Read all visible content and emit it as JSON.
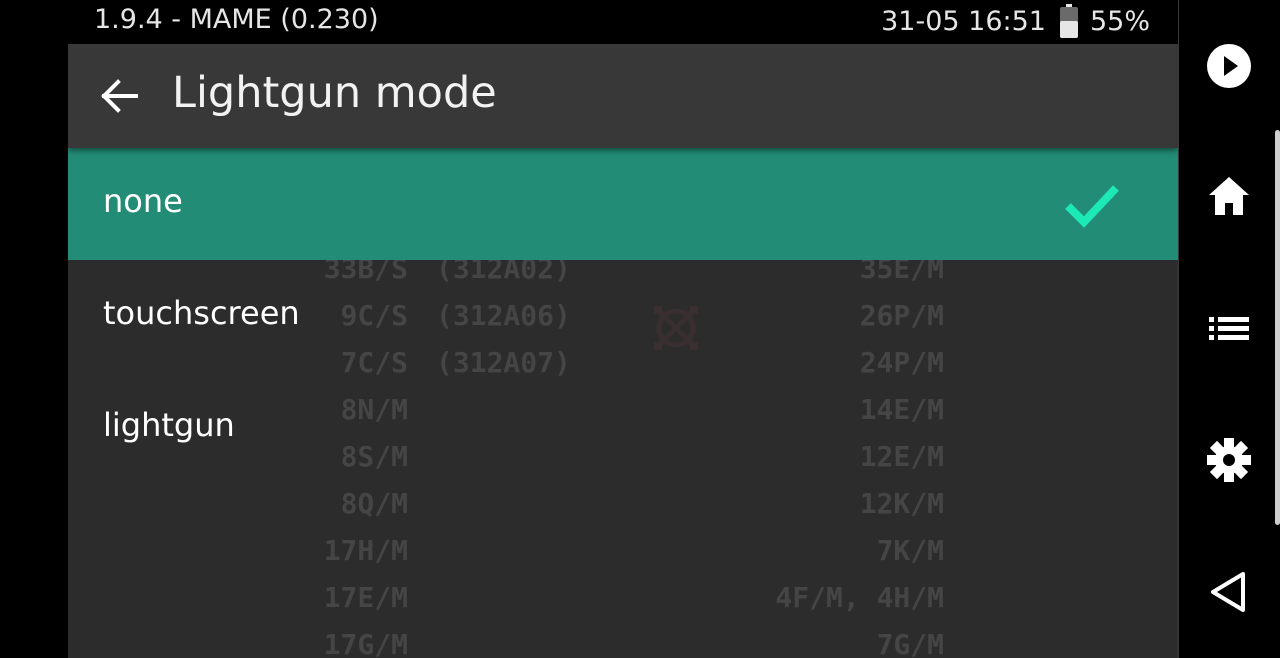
{
  "status_bar": {
    "app_info": "1.9.4 - MAME (0.230)",
    "datetime": "31-05 16:51",
    "battery_percent": "55%",
    "battery_level": 0.55,
    "battery_icon": "battery-icon"
  },
  "dialog": {
    "title": "Lightgun mode",
    "back_icon": "arrow-left-icon",
    "options": [
      {
        "label": "none",
        "selected": true
      },
      {
        "label": "touchscreen",
        "selected": false
      },
      {
        "label": "lightgun",
        "selected": false
      }
    ],
    "selected_color": "#238c76",
    "check_color": "#1de9b6",
    "check_icon": "check-icon"
  },
  "background_text": {
    "rows": [
      {
        "c1": "33B/S",
        "c2": "(312A02)",
        "c3": "35E/M"
      },
      {
        "c1": "9C/S",
        "c2": "(312A06)",
        "c3": "26P/M"
      },
      {
        "c1": "7C/S",
        "c2": "(312A07)",
        "c3": "24P/M"
      },
      {
        "c1": "8N/M",
        "c2": "",
        "c3": "14E/M"
      },
      {
        "c1": "8S/M",
        "c2": "",
        "c3": "12E/M"
      },
      {
        "c1": "8Q/M",
        "c2": "",
        "c3": "12K/M"
      },
      {
        "c1": "17H/M",
        "c2": "",
        "c3": "7K/M"
      },
      {
        "c1": "17E/M",
        "c2": "",
        "c3": "4F/M, 4H/M"
      },
      {
        "c1": "17G/M",
        "c2": "",
        "c3": "7G/M"
      }
    ]
  },
  "nav_bar": {
    "buttons": [
      {
        "icon": "play-icon"
      },
      {
        "icon": "home-icon"
      },
      {
        "icon": "list-icon"
      },
      {
        "icon": "gear-icon"
      },
      {
        "icon": "back-triangle-icon"
      }
    ]
  }
}
